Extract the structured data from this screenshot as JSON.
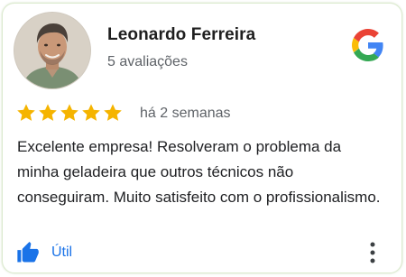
{
  "reviewer": {
    "name": "Leonardo Ferreira",
    "review_count": "5 avaliações"
  },
  "rating": {
    "stars": 5,
    "max_stars": 5,
    "time_ago": "há 2 semanas"
  },
  "review": {
    "text": "Excelente empresa! Resolveram o problema da minha geladeira que outros técnicos não conseguiram. Muito satisfeito com o profissionalismo."
  },
  "actions": {
    "helpful_label": "Útil"
  },
  "icons": {
    "brand": "google-icon",
    "star": "star-icon",
    "helpful": "thumbs-up-icon",
    "more": "more-vertical-icon"
  },
  "colors": {
    "star": "#f5b400",
    "accent": "#1a73e8",
    "google_blue": "#4285f4",
    "google_red": "#ea4335",
    "google_yellow": "#fbbc05",
    "google_green": "#34a853"
  }
}
